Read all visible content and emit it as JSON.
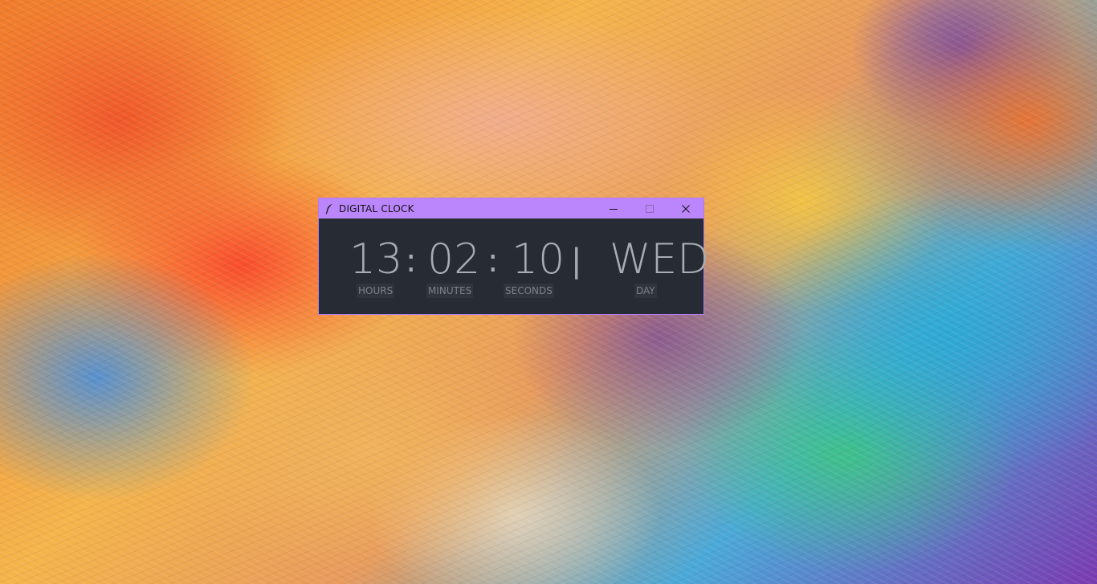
{
  "window": {
    "title": "DIGITAL CLOCK",
    "accent_color": "#bb86fc",
    "background_color": "#272b33",
    "app_icon": "feather-icon",
    "controls": {
      "minimize_icon": "minimize-icon",
      "maximize_icon": "maximize-icon",
      "close_icon": "close-icon"
    }
  },
  "clock": {
    "hours": "13",
    "minutes": "02",
    "seconds": "10",
    "separator": ":",
    "divider": "|",
    "day": "WED",
    "labels": {
      "hours": "HOURS",
      "minutes": "MINUTES",
      "seconds": "SECONDS",
      "day": "DAY"
    },
    "digit_color": "#a9acb2"
  }
}
